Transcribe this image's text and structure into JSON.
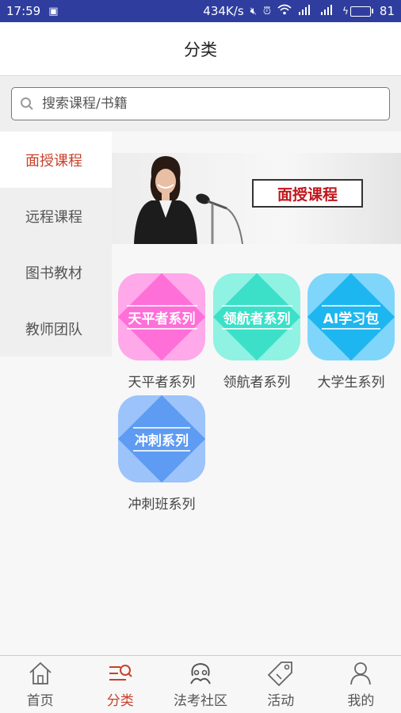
{
  "status_bar": {
    "time": "17:59",
    "network_speed": "434K/s",
    "battery": "81",
    "battery_level": 0.81
  },
  "header": {
    "title": "分类"
  },
  "search": {
    "placeholder": "搜索课程/书籍"
  },
  "sidebar": {
    "items": [
      {
        "label": "面授课程",
        "active": true
      },
      {
        "label": "远程课程",
        "active": false
      },
      {
        "label": "图书教材",
        "active": false
      },
      {
        "label": "教师团队",
        "active": false
      }
    ]
  },
  "banner": {
    "sign_text": "面授课程"
  },
  "courses": [
    {
      "badge": "天平者系列",
      "label": "天平者系列",
      "color": "#ff6fd8",
      "light": "#ffa8ea"
    },
    {
      "badge": "领航者系列",
      "label": "领航者系列",
      "color": "#3ce0c8",
      "light": "#8ff2e2"
    },
    {
      "badge": "AI学习包",
      "label": "大学生系列",
      "color": "#1eb6f0",
      "light": "#7fd6fa"
    },
    {
      "badge": "冲刺系列",
      "label": "冲刺班系列",
      "color": "#5e9bf2",
      "light": "#9cc3fa"
    }
  ],
  "bottom_nav": {
    "items": [
      {
        "label": "首页",
        "icon": "home-icon",
        "active": false
      },
      {
        "label": "分类",
        "icon": "category-search-icon",
        "active": true
      },
      {
        "label": "法考社区",
        "icon": "community-icon",
        "active": false
      },
      {
        "label": "活动",
        "icon": "tag-icon",
        "active": false
      },
      {
        "label": "我的",
        "icon": "profile-icon",
        "active": false
      }
    ]
  },
  "colors": {
    "accent": "#c9402b",
    "status_bar": "#2f3e9e"
  }
}
